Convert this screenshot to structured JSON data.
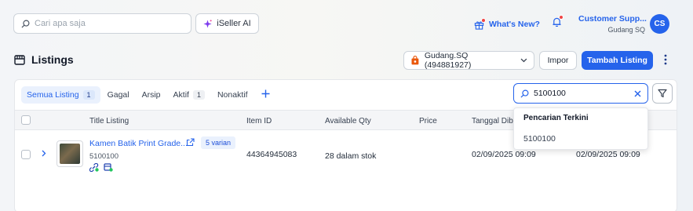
{
  "header": {
    "search_placeholder": "Cari apa saja",
    "ai_button_label": "iSeller AI",
    "whats_new_label": "What's New?",
    "user_name": "Customer Supp...",
    "user_store": "Gudang SQ",
    "avatar_initials": "CS"
  },
  "page": {
    "title": "Listings",
    "store_selector": "Gudang.SQ (494881927)",
    "import_label": "Impor",
    "add_listing_label": "Tambah Listing"
  },
  "tabs": [
    {
      "label": "Semua Listing",
      "count": "1",
      "active": true
    },
    {
      "label": "Gagal"
    },
    {
      "label": "Arsip"
    },
    {
      "label": "Aktif",
      "count": "1"
    },
    {
      "label": "Nonaktif"
    }
  ],
  "listing_search": {
    "value": "5100100",
    "dropdown_header": "Pencarian Terkini",
    "recent": [
      "5100100"
    ]
  },
  "table": {
    "columns": [
      "Title Listing",
      "Item ID",
      "Available Qty",
      "Price",
      "Tanggal Dibu"
    ],
    "rows": [
      {
        "title": "Kamen Batik Print Grade...",
        "variant_badge": "5 varian",
        "sku": "5100100",
        "item_id": "44364945083",
        "qty": "28 dalam stok",
        "price": "",
        "created": "02/09/2025 09:09",
        "updated": "02/09/2025 09:09"
      }
    ]
  },
  "colors": {
    "accent": "#2563eb",
    "notification": "#ef4444"
  }
}
